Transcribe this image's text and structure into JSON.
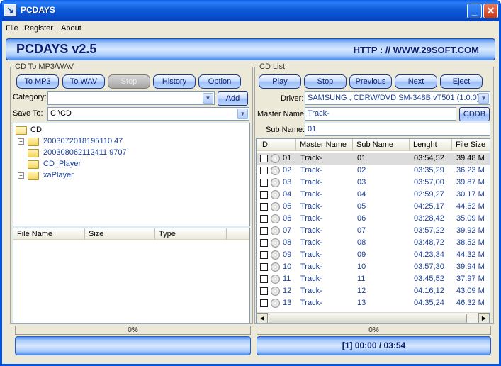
{
  "window": {
    "title": "PCDAYS"
  },
  "menu": [
    "File",
    "Register",
    "About"
  ],
  "banner": {
    "title": "PCDAYS v2.5",
    "url": "HTTP : // WWW.29SOFT.COM"
  },
  "left": {
    "group_label": "CD To MP3/WAV",
    "buttons": {
      "to_mp3": "To MP3",
      "to_wav": "To WAV",
      "stop": "Stop",
      "history": "History",
      "option": "Option"
    },
    "category_label": "Category:",
    "category_value": "",
    "add_label": "Add",
    "save_to_label": "Save To:",
    "save_to_value": "C:\\CD",
    "tree": {
      "root": "CD",
      "children": [
        "20030720181951104 7",
        "20030806211241197 07",
        "CD_Player",
        "xaPlayer"
      ]
    },
    "file_columns": [
      "File Name",
      "Size",
      "Type"
    ],
    "progress": "0%"
  },
  "right": {
    "group_label": "CD List",
    "buttons": {
      "play": "Play",
      "stop": "Stop",
      "previous": "Previous",
      "next": "Next",
      "eject": "Eject"
    },
    "driver_label": "Driver:",
    "driver_value": "SAMSUNG , CDRW/DVD SM-348B vT501 (1:0:0)",
    "master_name_label": "Master Name:",
    "master_name_value": "Track-",
    "cddb_label": "CDDB",
    "sub_name_label": "Sub Name:",
    "sub_name_value": "01",
    "columns": [
      "ID",
      "Master Name",
      "Sub Name",
      "Lenght",
      "File Size"
    ],
    "tracks": [
      {
        "id": "01",
        "master": "Track-",
        "sub": "01",
        "length": "03:54,52",
        "size": "39.48 M"
      },
      {
        "id": "02",
        "master": "Track-",
        "sub": "02",
        "length": "03:35,29",
        "size": "36.23 M"
      },
      {
        "id": "03",
        "master": "Track-",
        "sub": "03",
        "length": "03:57,00",
        "size": "39.87 M"
      },
      {
        "id": "04",
        "master": "Track-",
        "sub": "04",
        "length": "02:59,27",
        "size": "30.17 M"
      },
      {
        "id": "05",
        "master": "Track-",
        "sub": "05",
        "length": "04:25,17",
        "size": "44.62 M"
      },
      {
        "id": "06",
        "master": "Track-",
        "sub": "06",
        "length": "03:28,42",
        "size": "35.09 M"
      },
      {
        "id": "07",
        "master": "Track-",
        "sub": "07",
        "length": "03:57,22",
        "size": "39.92 M"
      },
      {
        "id": "08",
        "master": "Track-",
        "sub": "08",
        "length": "03:48,72",
        "size": "38.52 M"
      },
      {
        "id": "09",
        "master": "Track-",
        "sub": "09",
        "length": "04:23,34",
        "size": "44.32 M"
      },
      {
        "id": "10",
        "master": "Track-",
        "sub": "10",
        "length": "03:57,30",
        "size": "39.94 M"
      },
      {
        "id": "11",
        "master": "Track-",
        "sub": "11",
        "length": "03:45,52",
        "size": "37.97 M"
      },
      {
        "id": "12",
        "master": "Track-",
        "sub": "12",
        "length": "04:16,12",
        "size": "43.09 M"
      },
      {
        "id": "13",
        "master": "Track-",
        "sub": "13",
        "length": "04:35,24",
        "size": "46.32 M"
      }
    ],
    "progress": "0%",
    "status": "[1]  00:00 / 03:54"
  }
}
